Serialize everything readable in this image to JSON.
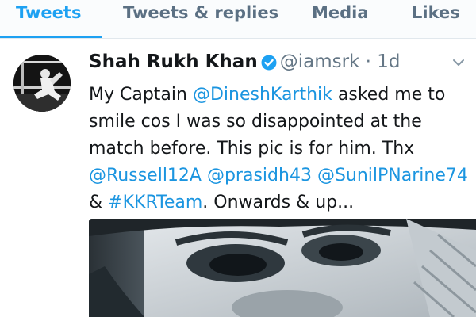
{
  "tabs": [
    {
      "label": "Tweets",
      "active": true
    },
    {
      "label": "Tweets & replies",
      "active": false
    },
    {
      "label": "Media",
      "active": false
    },
    {
      "label": "Likes",
      "active": false
    }
  ],
  "tweet": {
    "author_name": "Shah Rukh Khan",
    "handle": "@iamsrk",
    "separator": "·",
    "time": "1d",
    "verified_icon": "verified-badge-icon",
    "menu_icon": "chevron-down-icon",
    "lines": [
      {
        "t1": "My Captain ",
        "l1": "@DineshKarthik",
        "t2": " asked me to"
      },
      {
        "t1": "smile cos I was so disappointed at the"
      },
      {
        "t1": "match before. This pic is for him.  Thx"
      },
      {
        "l1": "@Russell12A",
        "t1": " ",
        "l2": "@prasidh43",
        "t2": "  ",
        "l3": "@SunilPNarine74"
      },
      {
        "t1": "& ",
        "l1": "#KKRTeam",
        "t2": ". Onwards & up..."
      }
    ]
  },
  "colors": {
    "accent": "#1da1f2",
    "link": "#1b95e0",
    "verified": "#1da1f2",
    "muted": "#657786"
  }
}
